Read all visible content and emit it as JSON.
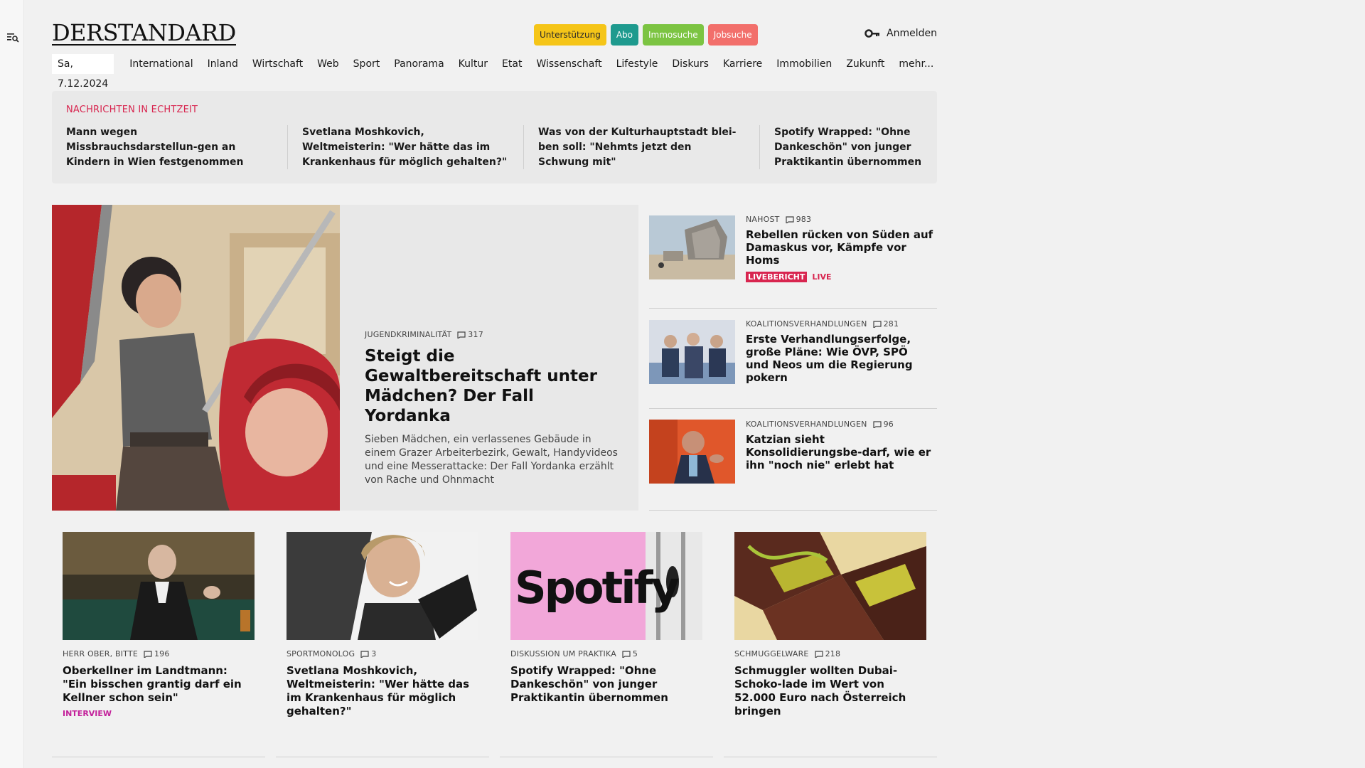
{
  "logo": "DERSTANDARD",
  "header": {
    "pills": [
      "Unterstützung",
      "Abo",
      "Immosuche",
      "Jobsuche"
    ],
    "login_label": "Anmelden",
    "login_icon": "key-icon",
    "menu_icon": "menu-search-icon"
  },
  "nav": {
    "date": "Sa, 7.12.2024",
    "items": [
      "International",
      "Inland",
      "Wirtschaft",
      "Web",
      "Sport",
      "Panorama",
      "Kultur",
      "Etat",
      "Wissenschaft",
      "Lifestyle",
      "Diskurs",
      "Karriere",
      "Immobilien",
      "Zukunft",
      "mehr..."
    ]
  },
  "ticker": {
    "label": "NACHRICHTEN IN ECHTZEIT",
    "items": [
      "Mann wegen Missbrauchsdarstellun-gen an Kindern in Wien festgenommen",
      "Svetlana Moshkovich, Weltmeisterin: \"Wer hätte das im Krankenhaus für möglich gehalten?\"",
      "Was von der Kulturhauptstadt blei-ben soll: \"Nehmts jetzt den Schwung mit\"",
      "Spotify Wrapped: \"Ohne Dankeschön\" von junger Praktikantin übernommen"
    ]
  },
  "hero": {
    "kicker": "JUGENDKRIMINALITÄT",
    "comments": "317",
    "title": "Steigt die Gewaltbereitschaft unter Mädchen? Der Fall Yordanka",
    "summary": "Sieben Mädchen, ein verlassenes Gebäude in einem Grazer Arbeiterbezirk, Gewalt, Handyvideos und eine Messerattacke: Der Fall Yordanka erzählt von Rache und Ohnmacht"
  },
  "side": [
    {
      "kicker": "NAHOST",
      "comments": "983",
      "title": "Rebellen rücken von Süden auf Damaskus vor, Kämpfe vor Homs",
      "flag": "LIVEBERICHT",
      "flag2": "LIVE"
    },
    {
      "kicker": "KOALITIONSVERHANDLUNGEN",
      "comments": "281",
      "title": "Erste Verhandlungserfolge, große Pläne: Wie ÖVP, SPÖ und Neos um die Regierung pokern"
    },
    {
      "kicker": "KOALITIONSVERHANDLUNGEN",
      "comments": "96",
      "title": "Katzian sieht Konsolidierungsbe-darf, wie er ihn \"noch nie\" erlebt hat"
    }
  ],
  "cards": [
    {
      "kicker": "HERR OBER, BITTE",
      "comments": "196",
      "title": "Oberkellner im Landtmann: \"Ein bisschen grantig darf ein Kellner schon sein\"",
      "badge": "INTERVIEW"
    },
    {
      "kicker": "SPORTMONOLOG",
      "comments": "3",
      "title": "Svetlana Moshkovich, Weltmeisterin: \"Wer hätte das im Krankenhaus für möglich gehalten?\""
    },
    {
      "kicker": "DISKUSSION UM PRAKTIKA",
      "comments": "5",
      "title": "Spotify Wrapped: \"Ohne Dankeschön\" von junger Praktikantin übernommen"
    },
    {
      "kicker": "SCHMUGGELWARE",
      "comments": "218",
      "title": "Schmuggler wollten Dubai-Schoko-lade im Wert von 52.000 Euro nach Österreich bringen"
    }
  ],
  "spotify_logo_text": "Spotify",
  "colors": {
    "accent": "#d8254f",
    "support": "#f5c518",
    "abo": "#1e9a8e",
    "immo": "#7cc442",
    "jobs": "#f26f6b",
    "badge": "#c3209a"
  }
}
